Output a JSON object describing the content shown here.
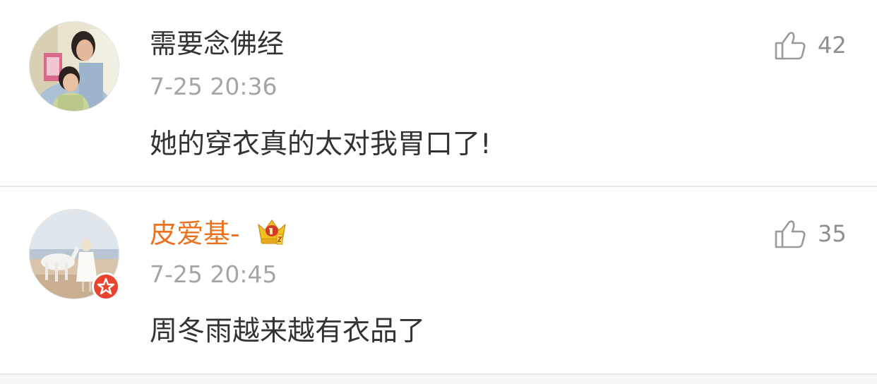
{
  "comments": [
    {
      "username": "需要念佛经",
      "timestamp": "7-25 20:36",
      "text": "她的穿衣真的太对我胃口了!",
      "likes": "42",
      "avatar_icon": "user-avatar-photo",
      "like_icon": "thumbs-up-icon"
    },
    {
      "username": "皮爱基-",
      "username_color": "#eb7320",
      "member_icon": "crown-member-icon",
      "badge_icon": "verified-star-badge-icon",
      "timestamp": "7-25 20:45",
      "text": "周冬雨越来越有衣品了",
      "likes": "35",
      "avatar_icon": "user-avatar-photo",
      "like_icon": "thumbs-up-icon"
    }
  ],
  "colors": {
    "username": "#333333",
    "vip_username": "#eb7320",
    "timestamp": "#a5a5a5",
    "like_count": "#8f8f8f",
    "divider": "#e6e6e6",
    "badge": "#e8442e"
  }
}
